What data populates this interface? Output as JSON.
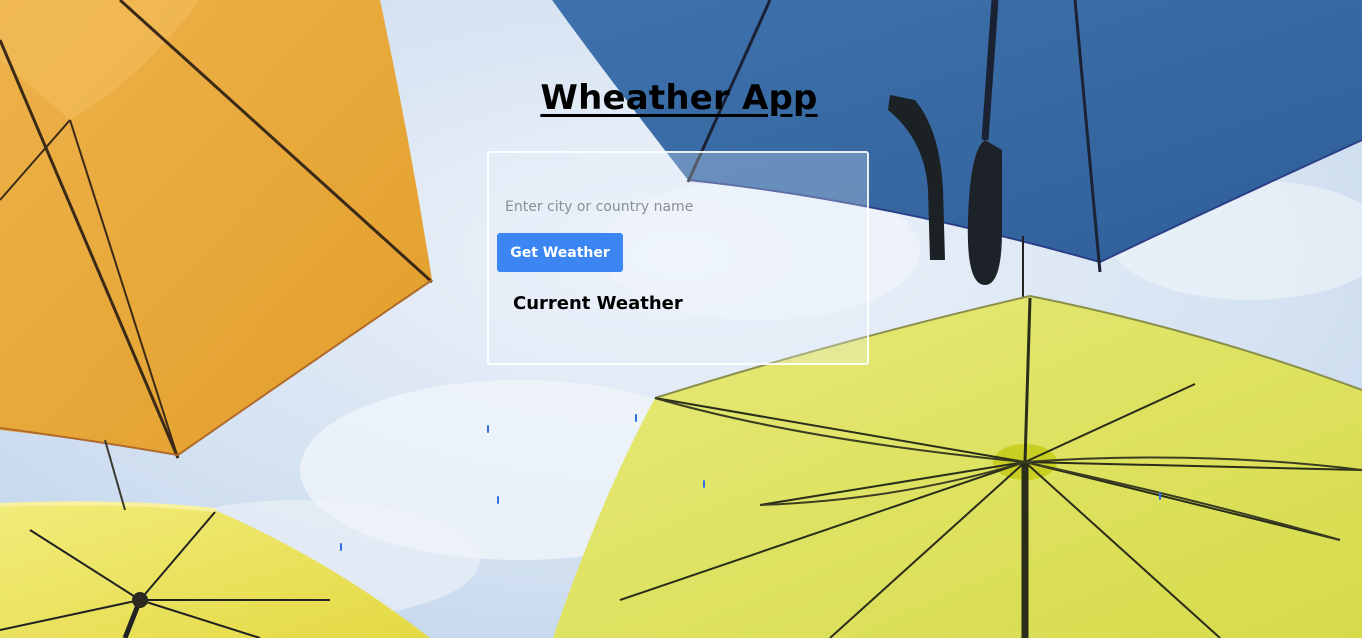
{
  "app": {
    "title": "Wheather App"
  },
  "search": {
    "placeholder": "Enter city or country name",
    "value": ""
  },
  "actions": {
    "get_weather_label": "Get Weather"
  },
  "weather": {
    "heading": "Current Weather"
  },
  "theme": {
    "button_color": "#3b86f2",
    "drop_color": "#2f6fe0",
    "umbrella_colors": [
      "#e8a634",
      "#3b6ea8",
      "#d9e04a",
      "#eadf55"
    ]
  },
  "background": {
    "icon": "umbrellas-photo"
  }
}
